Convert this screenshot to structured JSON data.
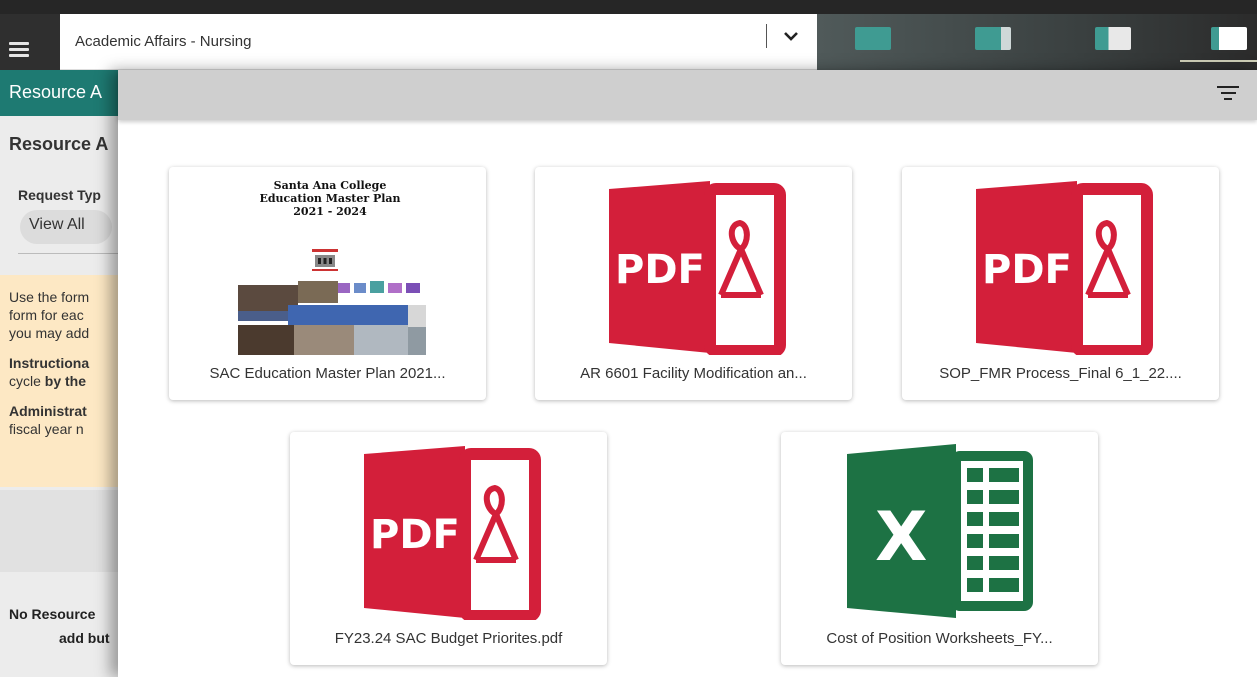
{
  "header": {
    "menu_icon": "hamburger-menu-icon",
    "selected_program": "Academic Affairs - Nursing",
    "dropdown_icon": "chevron-down-icon",
    "accent_color": "#3f9b92"
  },
  "left_panel": {
    "header_text": "Resource A",
    "subtitle": "Resource A",
    "request_type_label": "Request Typ",
    "view_all_label": "View All",
    "notice": {
      "line1": "Use the form",
      "line2": "form for eac",
      "line3": "you may add",
      "p2_line1": "Instructiona",
      "p2_line2_a": "cycle ",
      "p2_line2_b": "by the",
      "p3_line1": "Administrat",
      "p3_line2": "fiscal year n"
    },
    "no_resource_line1": "No Resource",
    "no_resource_line2": "add but"
  },
  "documents_panel": {
    "filter_icon": "filter-icon",
    "documents": [
      {
        "label": "SAC Education Master Plan 2021...",
        "type": "image",
        "cover_title_1": "Santa Ana College",
        "cover_title_2": "Education Master Plan",
        "cover_title_3": "2021 - 2024"
      },
      {
        "label": "AR 6601 Facility Modification an...",
        "type": "pdf",
        "icon_text": "PDF"
      },
      {
        "label": "SOP_FMR Process_Final 6_1_22....",
        "type": "pdf",
        "icon_text": "PDF"
      },
      {
        "label": "FY23.24 SAC Budget Priorites.pdf",
        "type": "pdf",
        "icon_text": "PDF"
      },
      {
        "label": "Cost of Position Worksheets_FY...",
        "type": "excel",
        "icon_text": "X"
      }
    ],
    "colors": {
      "pdf_red": "#d31f3a",
      "excel_green": "#1d7244"
    }
  }
}
